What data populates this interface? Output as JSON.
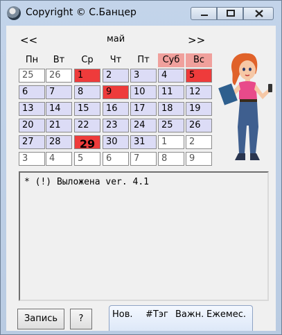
{
  "window": {
    "title": "Copyright © С.Банцер",
    "controls": {
      "minimize": "▭",
      "maximize": "▢",
      "close": "✕"
    }
  },
  "calendar": {
    "prev": "<<",
    "next": ">>",
    "month": "май",
    "weekdays": [
      "Пн",
      "Вт",
      "Ср",
      "Чт",
      "Пт",
      "Суб",
      "Вс"
    ],
    "weeks": [
      [
        "25",
        "26",
        "1",
        "2",
        "3",
        "4",
        "5"
      ],
      [
        "6",
        "7",
        "8",
        "9",
        "10",
        "11",
        "12"
      ],
      [
        "13",
        "14",
        "15",
        "16",
        "17",
        "18",
        "19"
      ],
      [
        "20",
        "21",
        "22",
        "23",
        "24",
        "25",
        "26"
      ],
      [
        "27",
        "28",
        "29",
        "30",
        "31",
        "1",
        "2"
      ],
      [
        "3",
        "4",
        "5",
        "6",
        "7",
        "8",
        "9"
      ]
    ],
    "today": "29",
    "colors": {
      "weekend_header": "#f0a09c",
      "marked": "#ee3b3b",
      "current_month": "#dcdcf6",
      "other_month": "#ffffff"
    }
  },
  "notes": {
    "text": "* (!) Выложена ver. 4.1"
  },
  "bottom": {
    "record_button": "Запись",
    "help_button": "?",
    "tabs": [
      "Нов.",
      "#Тэг",
      "Важн.",
      "Ежемес."
    ]
  },
  "mascot": {
    "icon": "girl-with-phone-illustration"
  }
}
